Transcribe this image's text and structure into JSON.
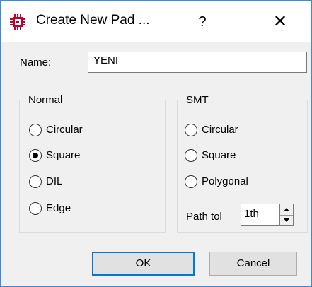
{
  "window": {
    "title": "Create New Pad ...",
    "help_label": "?",
    "close_label": "✕",
    "icon": "chip-icon"
  },
  "form": {
    "name_label": "Name:",
    "name_value": "YENI",
    "normal": {
      "legend": "Normal",
      "options": [
        {
          "label": "Circular",
          "checked": false
        },
        {
          "label": "Square",
          "checked": true
        },
        {
          "label": "DIL",
          "checked": false
        },
        {
          "label": "Edge",
          "checked": false
        }
      ]
    },
    "smt": {
      "legend": "SMT",
      "options": [
        {
          "label": "Circular",
          "checked": false
        },
        {
          "label": "Square",
          "checked": false
        },
        {
          "label": "Polygonal",
          "checked": false
        }
      ],
      "path_tol_label": "Path tol",
      "path_tol_value": "1th"
    }
  },
  "buttons": {
    "ok": "OK",
    "cancel": "Cancel"
  },
  "colors": {
    "accent": "#0078d7",
    "border": "#3c8ad8",
    "icon": "#c0002a"
  }
}
